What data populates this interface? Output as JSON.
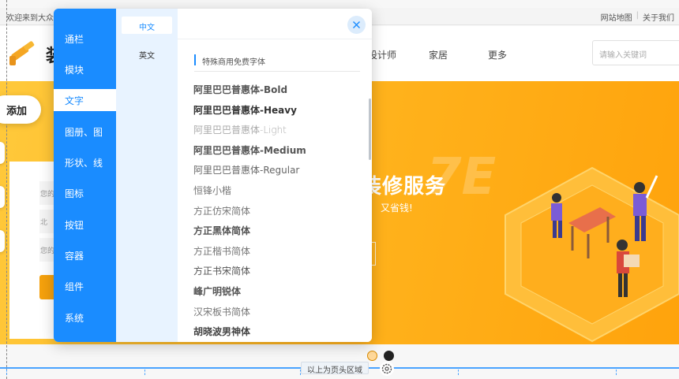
{
  "site": {
    "topbar": {
      "welcome": "欢迎来到大众",
      "links": [
        "网站地图",
        "关于我们"
      ],
      "separator": "|"
    },
    "logo_text": "装",
    "nav": [
      "设计师",
      "家居",
      "更多"
    ],
    "search_placeholder": "请输入关键词",
    "banner": {
      "title": "装修服务",
      "subtitle": "又省钱!",
      "watermark": "7E"
    },
    "form": {
      "fields": [
        "您的",
        "北",
        "您的"
      ]
    }
  },
  "editor": {
    "add_label": "添加",
    "header_area_label": "以上为页头区域"
  },
  "panel": {
    "categories": [
      {
        "label": "通栏",
        "active": false
      },
      {
        "label": "模块",
        "active": false
      },
      {
        "label": "文字",
        "active": true
      },
      {
        "label": "图册、图",
        "active": false
      },
      {
        "label": "形状、线",
        "active": false
      },
      {
        "label": "图标",
        "active": false
      },
      {
        "label": "按钮",
        "active": false
      },
      {
        "label": "容器",
        "active": false
      },
      {
        "label": "组件",
        "active": false
      },
      {
        "label": "系统",
        "active": false
      }
    ],
    "languages": [
      {
        "label": "中文",
        "active": true
      },
      {
        "label": "英文",
        "active": false
      }
    ],
    "section_title": "特殊商用免费字体",
    "fonts": [
      {
        "label": "阿里巴巴普惠体-Bold",
        "weight": "bold",
        "color": "#555555"
      },
      {
        "label": "阿里巴巴普惠体-Heavy",
        "weight": "900",
        "color": "#333333"
      },
      {
        "label": "阿里巴巴普惠体-Light",
        "weight": "300",
        "color": "#aaaaaa"
      },
      {
        "label": "阿里巴巴普惠体-Medium",
        "weight": "bold",
        "color": "#555555"
      },
      {
        "label": "阿里巴巴普惠体-Regular",
        "weight": "normal",
        "color": "#666666"
      },
      {
        "label": "恒锋小楷",
        "weight": "normal",
        "color": "#777777"
      },
      {
        "label": "方正仿宋简体",
        "weight": "normal",
        "color": "#777777"
      },
      {
        "label": "方正黑体简体",
        "weight": "bold",
        "color": "#555555"
      },
      {
        "label": "方正楷书简体",
        "weight": "normal",
        "color": "#777777"
      },
      {
        "label": "方正书宋简体",
        "weight": "normal",
        "color": "#555555"
      },
      {
        "label": "峰广明锐体",
        "weight": "bold",
        "color": "#555555"
      },
      {
        "label": "汉宋板书简体",
        "weight": "normal",
        "color": "#777777"
      },
      {
        "label": "胡晓波男神体",
        "weight": "bold",
        "color": "#444444"
      }
    ]
  },
  "colors": {
    "accent": "#1a8cff",
    "lang_bg": "#e8f3ff",
    "banner_orange": "#ffb51f",
    "guide_blue": "#4aa3ff"
  },
  "icons": {
    "close": "close-icon",
    "gear": "gear-icon",
    "logo": "paint-roller-logo-icon"
  }
}
